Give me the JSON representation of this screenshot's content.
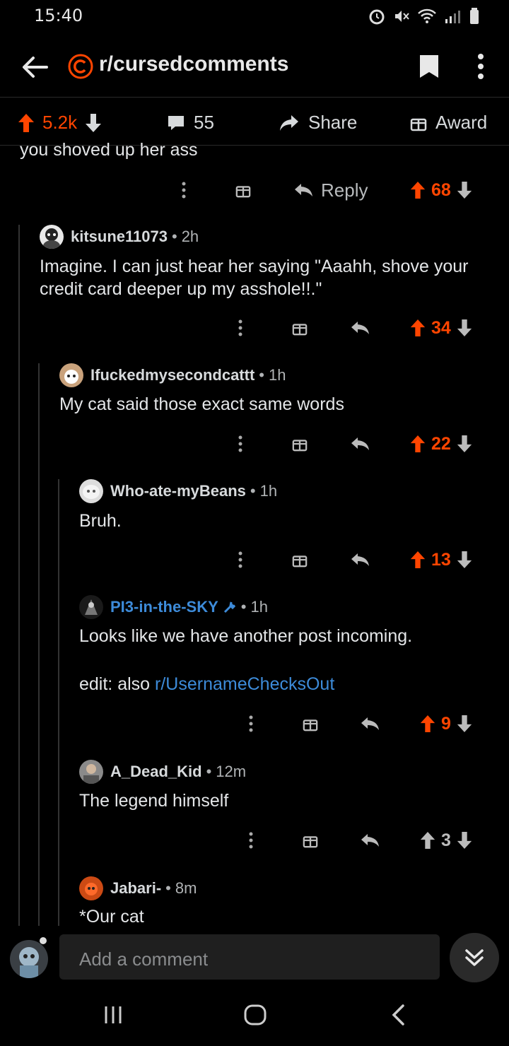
{
  "status_bar": {
    "time": "15:40"
  },
  "header": {
    "subreddit": "r/cursedcomments"
  },
  "actions": {
    "score": "5.2k",
    "comments": "55",
    "share": "Share",
    "award": "Award"
  },
  "partial_comment": {
    "text": "you shoved up her ass",
    "reply": "Reply",
    "score": "68"
  },
  "comments": [
    {
      "user": "kitsune11073",
      "sep": "•",
      "time": "2h",
      "text": "Imagine. I can just hear her saying \"Aaahh, shove your credit card deeper up my asshole!!.\"",
      "score": "34"
    },
    {
      "user": "Ifuckedmysecondcattt",
      "sep": "•",
      "time": "1h",
      "text": "My cat said those exact same words",
      "score": "22"
    },
    {
      "user": "Who-ate-myBeans",
      "sep": "•",
      "time": "1h",
      "text": "Bruh.",
      "score": "13"
    },
    {
      "user": "PI3-in-the-SKY",
      "sep": "•",
      "time": "1h",
      "text": "Looks like we have another post incoming.",
      "text2_prefix": "edit: also ",
      "text2_link": "r/UsernameChecksOut",
      "score": "9"
    },
    {
      "user": "A_Dead_Kid",
      "sep": "•",
      "time": "12m",
      "text": "The legend himself",
      "score": "3"
    },
    {
      "user": "Jabari-",
      "sep": "•",
      "time": "8m",
      "text": "*Our cat"
    }
  ],
  "composer": {
    "placeholder": "Add a comment"
  },
  "colors": {
    "upvote": "#ff4500",
    "mod_blue": "#3d8bd9",
    "background": "#000000"
  }
}
